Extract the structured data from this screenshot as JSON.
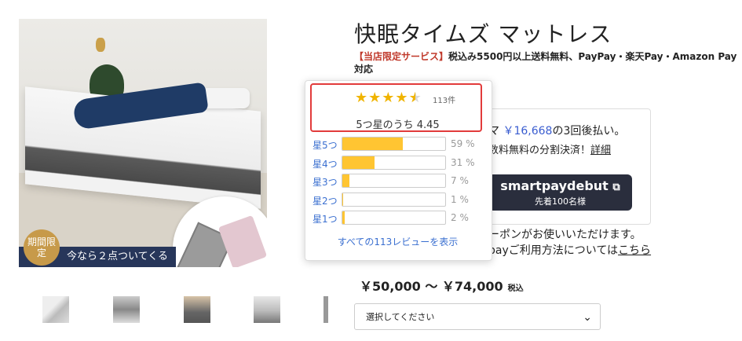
{
  "product": {
    "title": "快眠タイムズ マットレス",
    "service_label": "【当店限定サービス】",
    "service_text": "税込み5500円以上送料無料、PayPay・楽天Pay・Amazon Pay対応",
    "price_range": "￥50,000 〜 ￥74,000",
    "tax_label": "税込"
  },
  "image": {
    "banner_text": "今なら２点ついてくる",
    "badge_text": "期間限定"
  },
  "rating": {
    "stars": 4.45,
    "count": "113件",
    "average_text": "5つ星のうち 4.45",
    "breakdown": [
      {
        "label": "星5つ",
        "percent": 59,
        "percent_text": "59 %"
      },
      {
        "label": "星4つ",
        "percent": 31,
        "percent_text": "31 %"
      },
      {
        "label": "星3つ",
        "percent": 7,
        "percent_text": "7 %"
      },
      {
        "label": "星2つ",
        "percent": 1,
        "percent_text": "1 %"
      },
      {
        "label": "星1つ",
        "percent": 2,
        "percent_text": "2 %"
      }
    ],
    "all_reviews_link": "すべての113レビューを表示",
    "star_color": "#f0b400",
    "bar_color": "#ffc532",
    "highlight_color": "#e23b3b"
  },
  "smartpay": {
    "line1_prefix": "マ",
    "line1_price": "￥16,668",
    "line1_suffix": "の3回後払い。",
    "line2_text": "数料無料の分割決済！",
    "line2_link": "詳細",
    "button_logo": "smartpaydebut",
    "button_sub": "先着100名様",
    "coupon_text": "ーポンがお使いいただけます。",
    "howto_text": "payご利用方法については",
    "howto_link": "こちら"
  },
  "variant_select": {
    "placeholder": "選択してください"
  }
}
